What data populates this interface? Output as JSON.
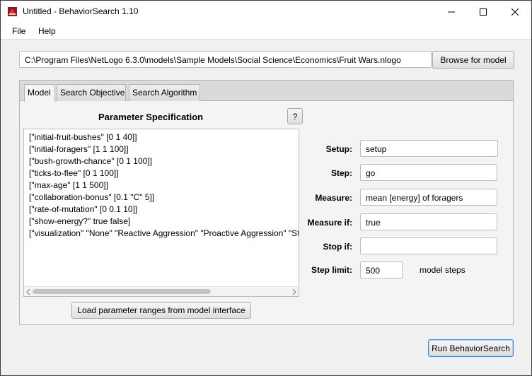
{
  "window": {
    "title": "Untitled - BehaviorSearch 1.10",
    "app_icon": "behaviorsearch-app-icon"
  },
  "menu": {
    "items": [
      "File",
      "Help"
    ]
  },
  "model_path": {
    "value": "C:\\Program Files\\NetLogo 6.3.0\\models\\Sample Models\\Social Science\\Economics\\Fruit Wars.nlogo",
    "browse_label": "Browse for model"
  },
  "tabs": [
    {
      "label": "Model",
      "active": true
    },
    {
      "label": "Search Objective",
      "active": false
    },
    {
      "label": "Search Algorithm",
      "active": false
    }
  ],
  "parameter_spec": {
    "title": "Parameter Specification",
    "help_label": "?",
    "lines": [
      "[\"initial-fruit-bushes\" [0 1 40]]",
      "[\"initial-foragers\" [1 1 100]]",
      "[\"bush-growth-chance\" [0 1 100]]",
      "[\"ticks-to-flee\" [0 1 100]]",
      "[\"max-age\" [1 1 500]]",
      "[\"collaboration-bonus\" [0.1 \"C\" 5]]",
      "[\"rate-of-mutation\" [0 0.1 10]]",
      "[\"show-energy?\" true false]",
      "[\"visualization\" \"None\" \"Reactive Aggression\" \"Proactive Aggression\" \"St"
    ],
    "load_label": "Load parameter ranges from model interface"
  },
  "settings": {
    "setup": {
      "label": "Setup:",
      "value": "setup"
    },
    "step": {
      "label": "Step:",
      "value": "go"
    },
    "measure": {
      "label": "Measure:",
      "value": "mean [energy] of foragers"
    },
    "measure_if": {
      "label": "Measure if:",
      "value": "true"
    },
    "stop_if": {
      "label": "Stop if:",
      "value": ""
    },
    "step_limit": {
      "label": "Step limit:",
      "value": "500",
      "suffix": "model steps"
    }
  },
  "run_label": "Run BehaviorSearch",
  "colors": {
    "accent_focus": "#3c8ce0",
    "icon_red": "#d92b2b"
  }
}
